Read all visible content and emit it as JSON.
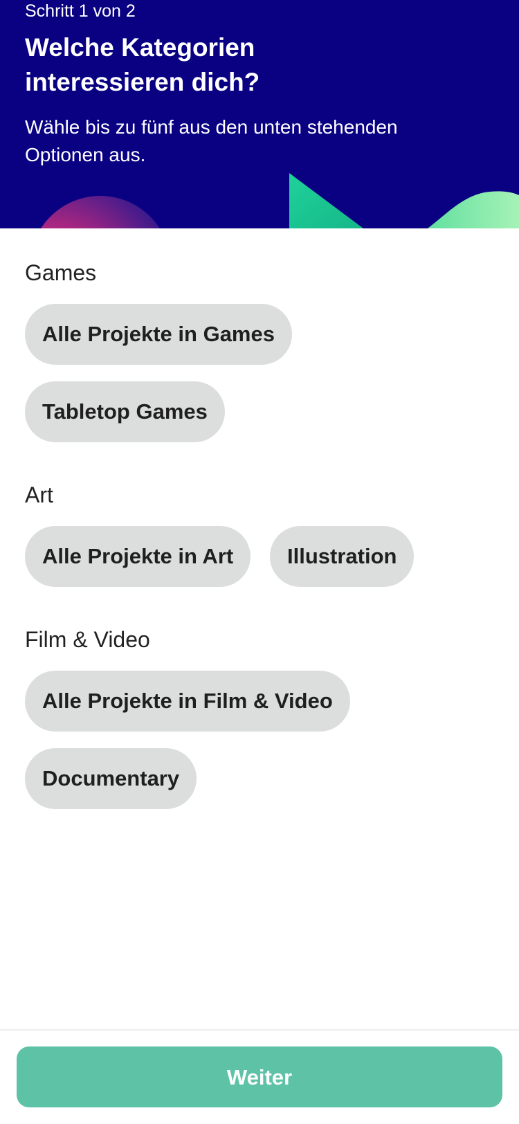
{
  "header": {
    "step": "Schritt 1 von 2",
    "title": "Welche Kategorien interessieren dich?",
    "subtitle": "Wähle bis zu fünf aus den unten stehenden Optionen aus."
  },
  "sections": [
    {
      "title": "Games",
      "chips": [
        "Alle Projekte in Games",
        "Tabletop Games"
      ]
    },
    {
      "title": "Art",
      "chips": [
        "Alle Projekte in Art",
        "Illustration"
      ]
    },
    {
      "title": "Film & Video",
      "chips": [
        "Alle Projekte in Film & Video",
        "Documentary"
      ]
    }
  ],
  "footer": {
    "continue_label": "Weiter"
  },
  "colors": {
    "header_bg": "#0a0182",
    "chip_bg": "#dcdddd",
    "accent": "#5ec2a7"
  }
}
